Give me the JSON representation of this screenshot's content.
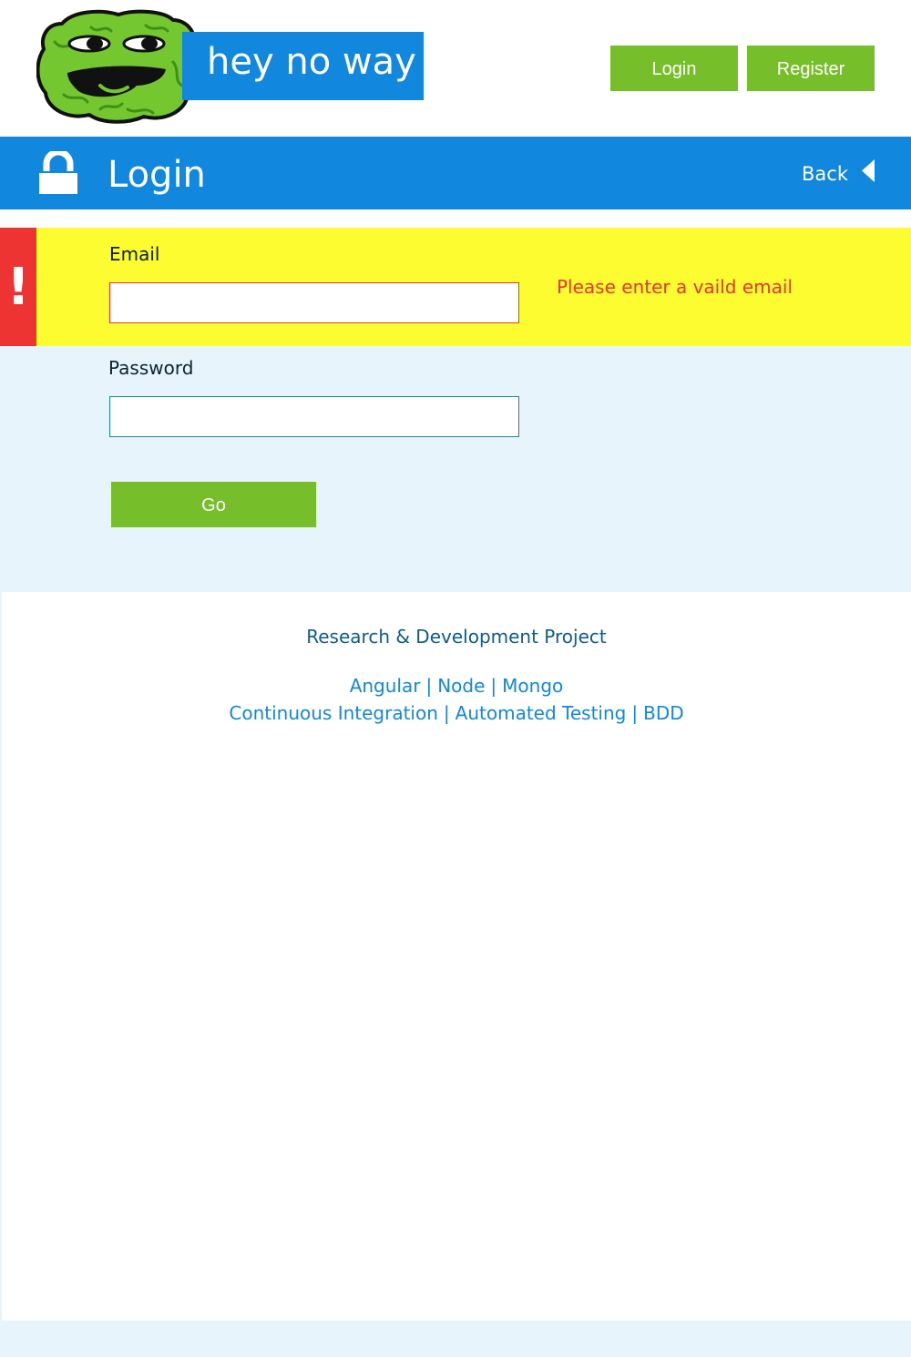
{
  "header": {
    "logo_text": "hey no way",
    "login_label": "Login",
    "register_label": "Register"
  },
  "title_bar": {
    "title": "Login",
    "back_label": "Back"
  },
  "form": {
    "email_label": "Email",
    "email_value": "",
    "email_error": "Please enter a vaild email",
    "error_icon": "!",
    "password_label": "Password",
    "password_value": "",
    "go_label": "Go"
  },
  "footer": {
    "title": "Research & Development Project",
    "tech_links": [
      "Angular",
      "Node",
      "Mongo"
    ],
    "practice_links": [
      "Continuous Integration",
      "Automated Testing",
      "BDD"
    ],
    "separator": "|"
  },
  "colors": {
    "brand_blue": "#1188dd",
    "accent_green": "#77bf2a",
    "error_red": "#ee3333",
    "error_highlight": "#fcfc30",
    "form_background": "#e8f4fc"
  },
  "icons": {
    "logo": "green-mascot-logo",
    "title": "lock-icon",
    "back": "caret-left-icon",
    "error": "exclamation-icon"
  }
}
